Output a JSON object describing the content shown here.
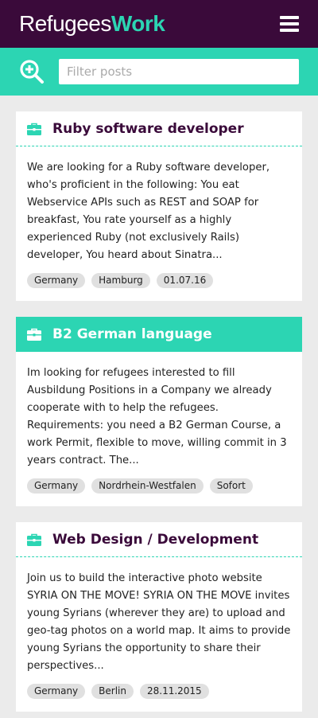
{
  "header": {
    "logo_left": "Refugees",
    "logo_right": "Work"
  },
  "filter": {
    "placeholder": "Filter posts",
    "value": ""
  },
  "colors": {
    "brand_dark": "#3a0a3a",
    "accent": "#2cd5b3"
  },
  "posts": [
    {
      "title": "Ruby software developer",
      "text": "We are looking for a Ruby software developer, who's proficient in the following: You eat Webservice APIs such as REST and SOAP for breakfast, You rate yourself as a highly experienced Ruby (not exclusively Rails) developer, You heard about Sinatra...",
      "tags": [
        "Germany",
        "Hamburg",
        "01.07.16"
      ]
    },
    {
      "title": "B2 German language",
      "text": "Im looking for refugees interested to fill Ausbildung Positions in a Company we already cooperate with to help the refugees. Requirements: you need a B2 German Course, a work Permit, flexible to move, willing commit in 3 years contract. The...",
      "tags": [
        "Germany",
        "Nordrhein-Westfalen",
        "Sofort"
      ]
    },
    {
      "title": "Web Design / Development",
      "text": "Join us to build the interactive photo website SYRIA ON THE MOVE! SYRIA ON THE MOVE invites young Syrians (wherever they are) to upload and geo-tag photos on a world map. It aims to provide young Syrians the opportunity to share their perspectives...",
      "tags": [
        "Germany",
        "Berlin",
        "28.11.2015"
      ]
    }
  ]
}
